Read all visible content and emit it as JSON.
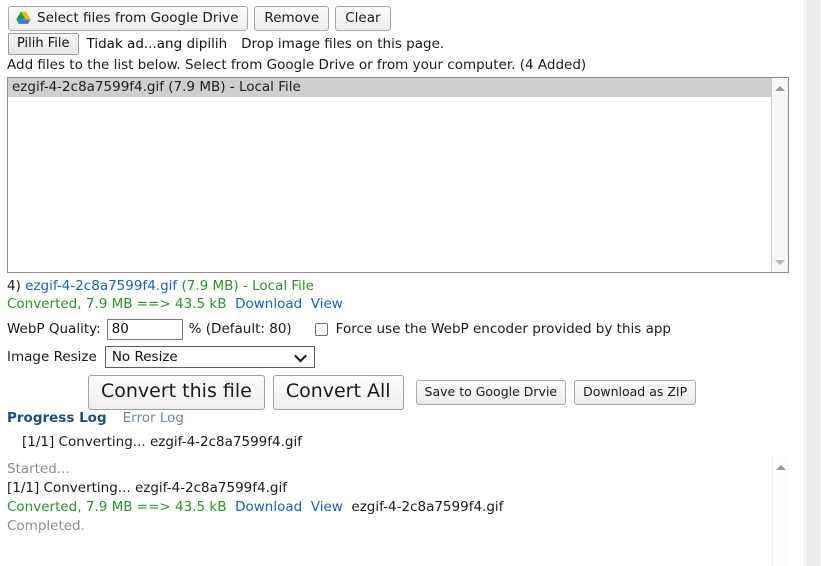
{
  "toolbar": {
    "google_drive_button": "Select files from Google Drive",
    "google_drive_icon": "google-drive-icon",
    "remove_button": "Remove",
    "clear_button": "Clear"
  },
  "file_picker": {
    "choose_button": "Pilih File",
    "status_text": "Tidak ad...ang dipilih",
    "drop_hint": "Drop image files on this page."
  },
  "instructions": "Add files to the list below. Select from Google Drive or from your computer. (4 Added)",
  "file_list": {
    "items": [
      {
        "label": "ezgif-4-2c8a7599f4.gif (7.9 MB) - Local File",
        "selected": true
      }
    ],
    "scrollbar": {
      "up_arrow_icon": "triangle-up-icon",
      "down_arrow_icon": "triangle-down-icon"
    }
  },
  "result": {
    "index": "4)",
    "filename": "ezgif-4-2c8a7599f4.gif",
    "size_and_source": "(7.9 MB) - Local File",
    "converted_text": "Converted, 7.9 MB ==> 43.5 kB",
    "download_link": "Download",
    "view_link": "View"
  },
  "options": {
    "quality_label": "WebP Quality:",
    "quality_value": "80",
    "quality_placeholder": "80",
    "quality_suffix": "% (Default: 80)",
    "force_encoder_label": "Force use the WebP encoder provided by this app",
    "force_encoder_checked": false,
    "resize_label": "Image Resize",
    "resize_value": "No Resize",
    "resize_options": [
      "No Resize"
    ],
    "chevron_icon": "chevron-down-icon"
  },
  "actions": {
    "convert_this_file": "Convert this file",
    "convert_all": "Convert All",
    "save_to_drive": "Save to Google Drvie",
    "download_zip": "Download as ZIP"
  },
  "log_tabs": {
    "progress_log": "Progress Log",
    "error_log": "Error Log",
    "active": "Progress Log"
  },
  "progress_status": "[1/1] Converting... ezgif-4-2c8a7599f4.gif",
  "log": {
    "started": "Started...",
    "converting": "[1/1] Converting... ezgif-4-2c8a7599f4.gif",
    "converted": "Converted, 7.9 MB ==> 43.5 kB",
    "download_link": "Download",
    "view_link": "View",
    "converted_filename": "ezgif-4-2c8a7599f4.gif",
    "completed": "Completed.",
    "scroll_up_icon": "triangle-up-icon"
  },
  "colors": {
    "link": "#1a62b5",
    "success": "#2f8f2f",
    "tab_active": "#1f4e79",
    "tab_inactive": "#6f8aa6",
    "muted": "#8d8d8d",
    "selected_row": "#cfcfcf"
  }
}
